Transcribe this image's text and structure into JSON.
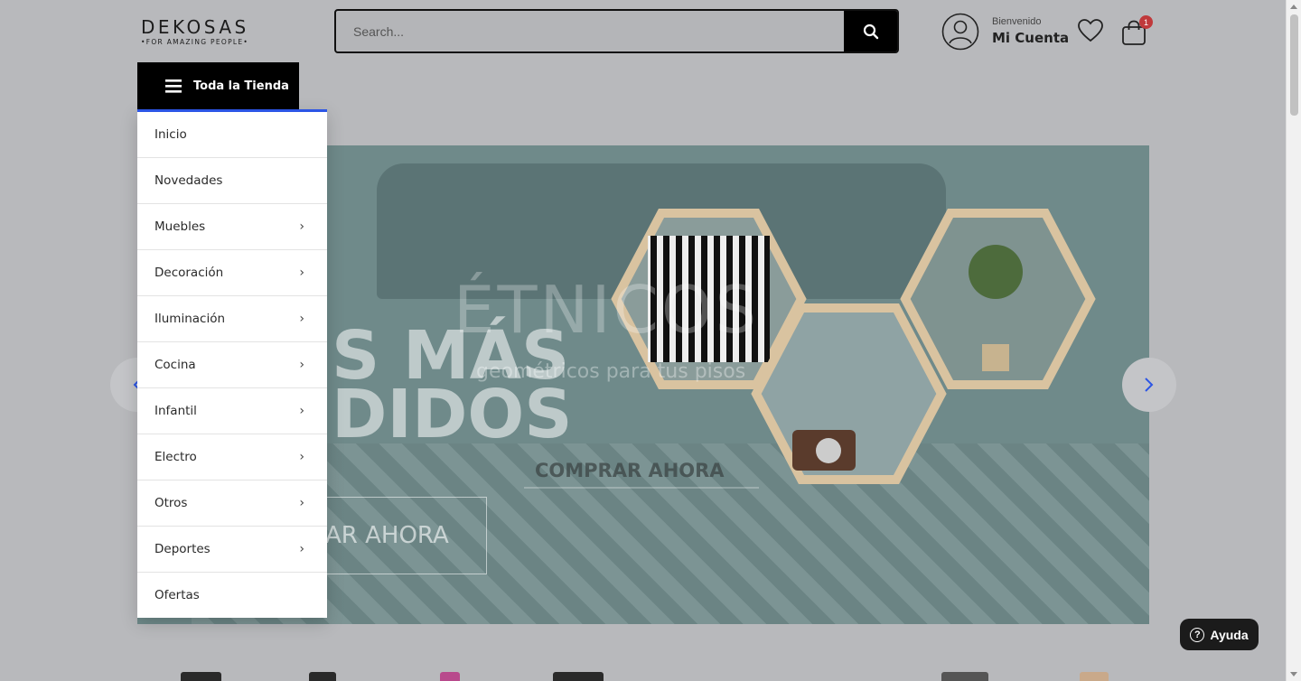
{
  "header": {
    "logo_name": "DEKOSAS",
    "logo_tagline": "•FOR AMAZING PEOPLE•",
    "search_placeholder": "Search...",
    "account_greeting": "Bienvenido",
    "account_label": "Mi Cuenta",
    "cart_count": "1"
  },
  "store_menu": {
    "button_label": "Toda la Tienda",
    "accent_color": "#2c55e5",
    "items": [
      {
        "label": "Inicio",
        "has_submenu": false
      },
      {
        "label": "Novedades",
        "has_submenu": false
      },
      {
        "label": "Muebles",
        "has_submenu": true
      },
      {
        "label": "Decoración",
        "has_submenu": true
      },
      {
        "label": "Iluminación",
        "has_submenu": true
      },
      {
        "label": "Cocina",
        "has_submenu": true
      },
      {
        "label": "Infantil",
        "has_submenu": true
      },
      {
        "label": "Electro",
        "has_submenu": true
      },
      {
        "label": "Otros",
        "has_submenu": true
      },
      {
        "label": "Deportes",
        "has_submenu": true
      },
      {
        "label": "Ofertas",
        "has_submenu": false
      }
    ]
  },
  "banner": {
    "slide_a_line1": "S MÁS",
    "slide_a_line2": "DIDOS",
    "slide_a_cta": "RAR AHORA",
    "slide_b_title": "ÉTNICOS",
    "slide_b_subtitle": "geométricos para tus pisos",
    "slide_b_cta": "COMPRAR AHORA"
  },
  "help": {
    "label": "Ayuda"
  },
  "colors": {
    "badge": "#c0393b",
    "arrow_icon": "#2c55e5"
  }
}
